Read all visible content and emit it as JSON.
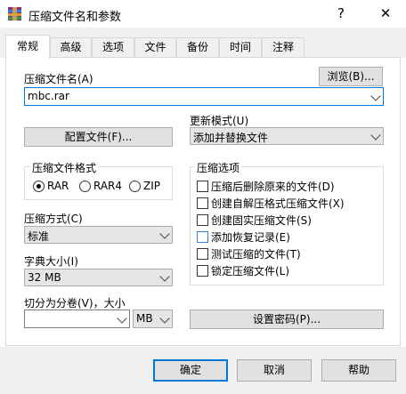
{
  "window": {
    "title": "压缩文件名和参数",
    "help": "?",
    "close": "✕"
  },
  "tabs": [
    {
      "label": "常规"
    },
    {
      "label": "高级"
    },
    {
      "label": "选项"
    },
    {
      "label": "文件"
    },
    {
      "label": "备份"
    },
    {
      "label": "时间"
    },
    {
      "label": "注释"
    }
  ],
  "archive": {
    "name_label": "压缩文件名(A)",
    "name_value": "mbc.rar",
    "browse": "浏览(B)..."
  },
  "update_mode": {
    "label": "更新模式(U)",
    "value": "添加并替换文件"
  },
  "profile_button": "配置文件(F)...",
  "format": {
    "label": "压缩文件格式",
    "options": [
      "RAR",
      "RAR4",
      "ZIP"
    ],
    "selected": "RAR"
  },
  "method": {
    "label": "压缩方式(C)",
    "value": "标准"
  },
  "dict": {
    "label": "字典大小(I)",
    "value": "32 MB"
  },
  "split": {
    "label": "切分为分卷(V)，大小",
    "value": "",
    "unit": "MB"
  },
  "options": {
    "label": "压缩选项",
    "items": [
      {
        "label": "压缩后删除原来的文件(D)",
        "checked": false
      },
      {
        "label": "创建自解压格式压缩文件(X)",
        "checked": false
      },
      {
        "label": "创建固实压缩文件(S)",
        "checked": false
      },
      {
        "label": "添加恢复记录(E)",
        "checked": false
      },
      {
        "label": "测试压缩的文件(T)",
        "checked": false
      },
      {
        "label": "锁定压缩文件(L)",
        "checked": false
      }
    ]
  },
  "password_button": "设置密码(P)...",
  "footer": {
    "ok": "确定",
    "cancel": "取消",
    "help": "帮助"
  },
  "colors": {
    "accent": "#0078d7",
    "button_bg": "#e1e1e1",
    "dialog_bg": "#f0f0f0"
  }
}
